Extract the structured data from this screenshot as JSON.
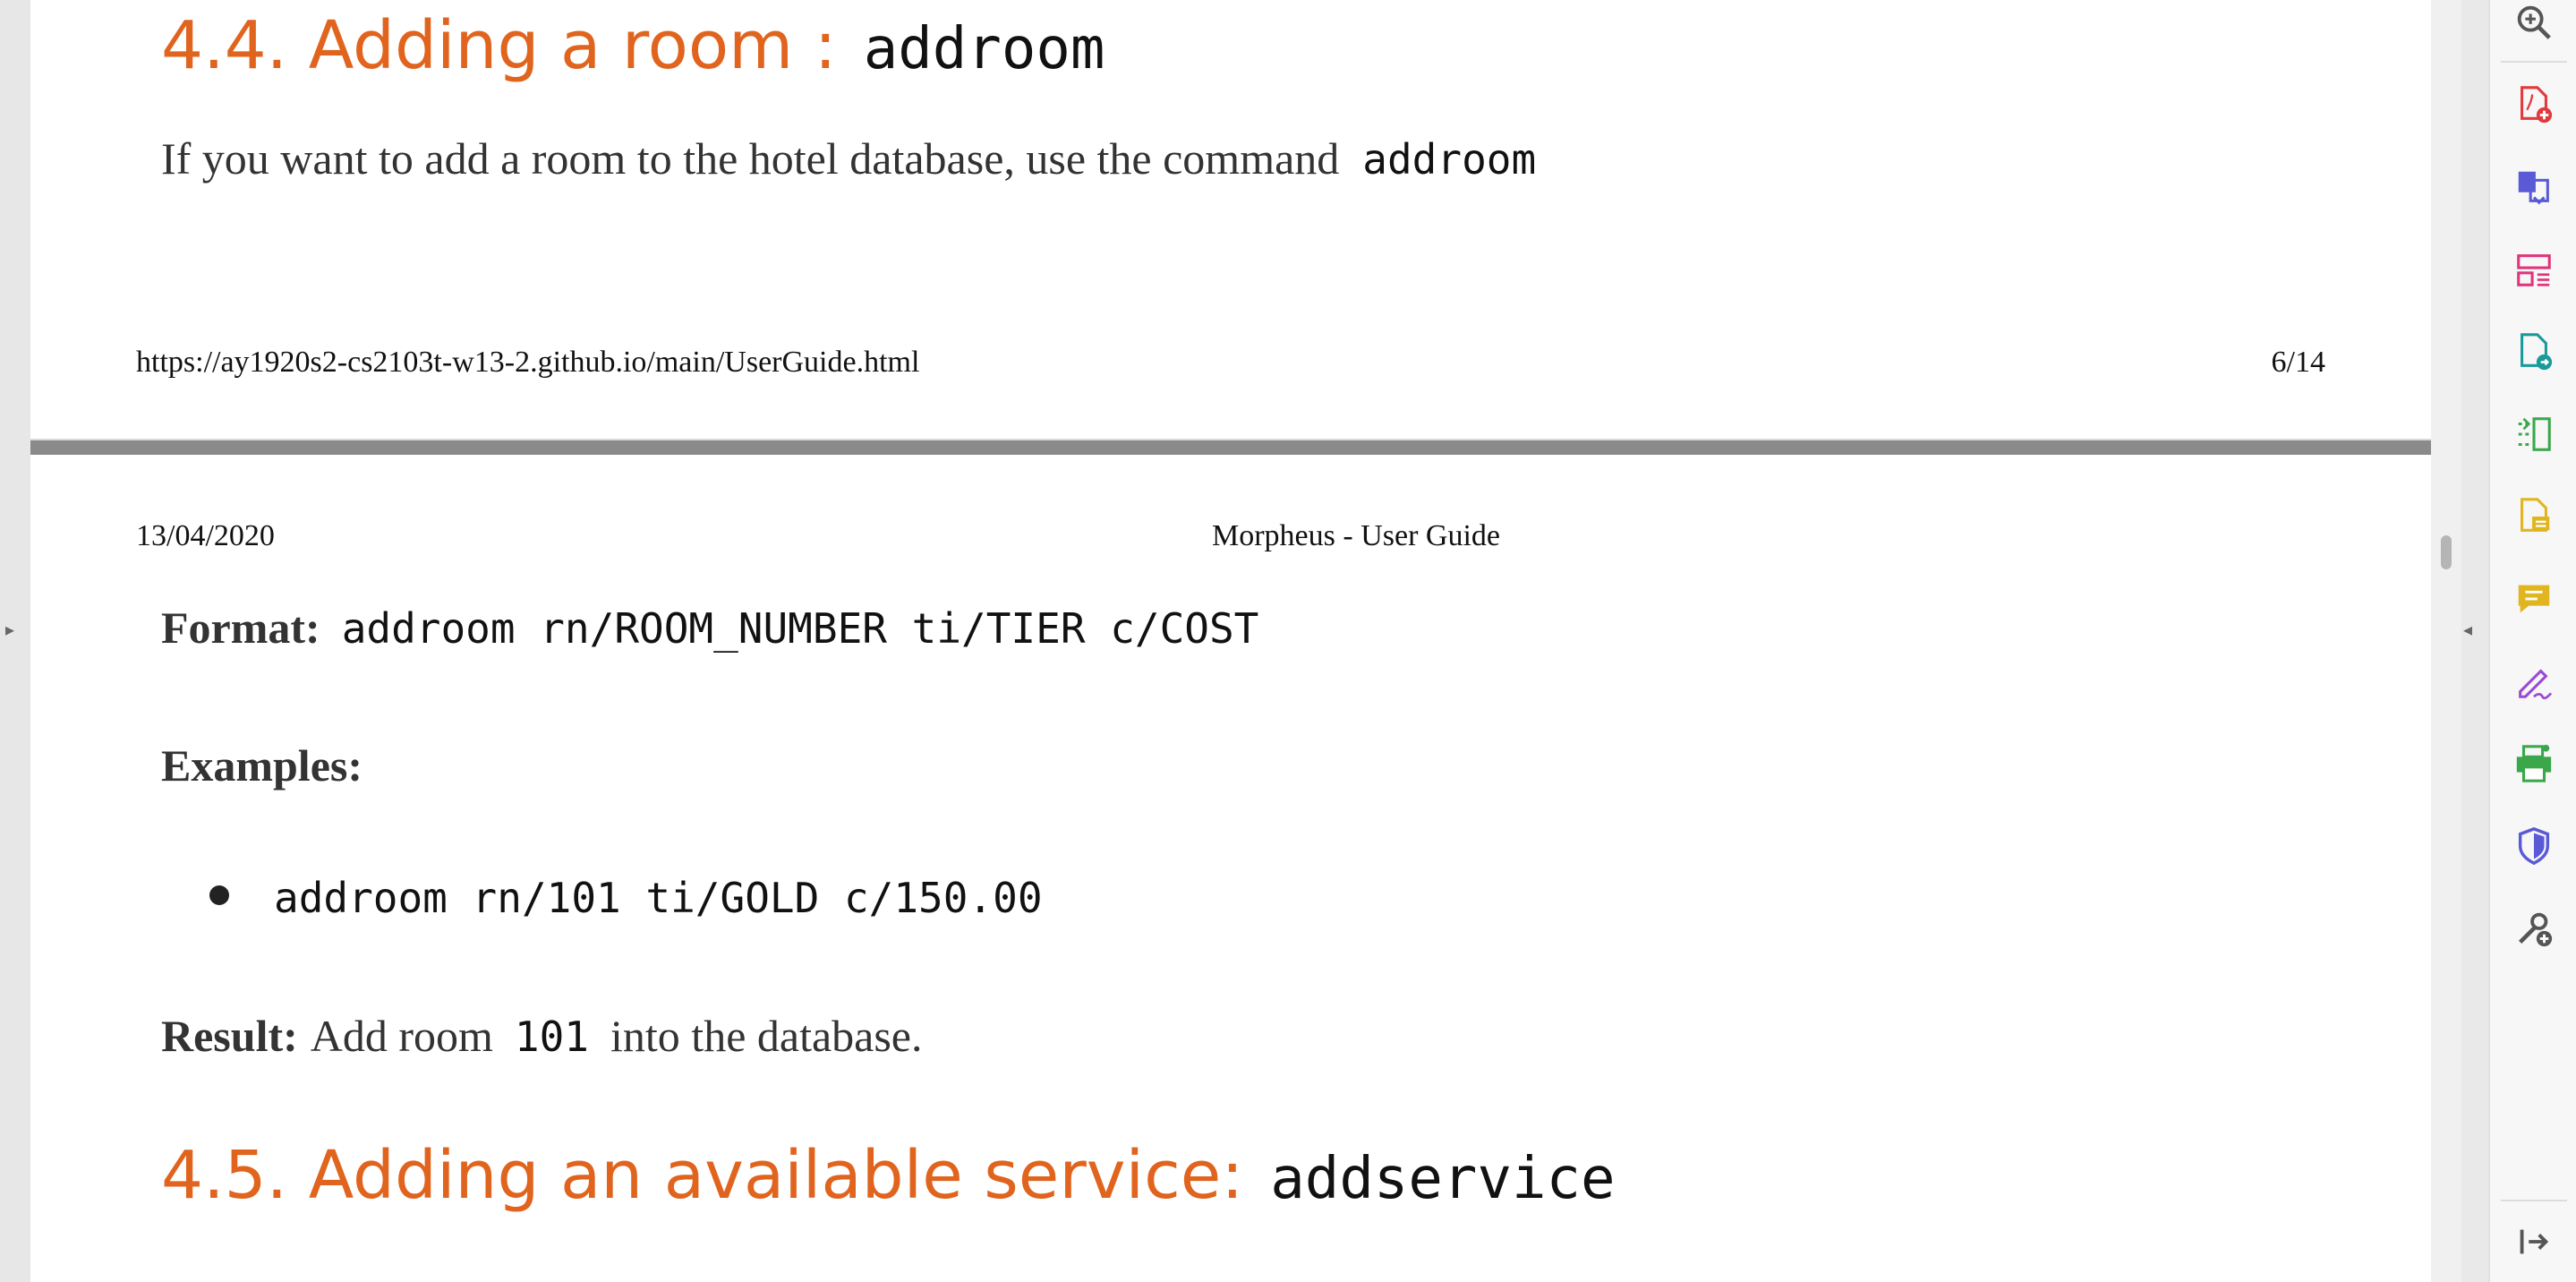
{
  "page1": {
    "heading": "4.4. Adding a room :",
    "heading_command": "addroom",
    "intro": "If you want to add a room to the hotel database, use the command",
    "intro_command": "addroom",
    "footer_url": "https://ay1920s2-cs2103t-w13-2.github.io/main/UserGuide.html",
    "footer_page": "6/14"
  },
  "page2": {
    "header_date": "13/04/2020",
    "header_title": "Morpheus - User Guide",
    "format_label": "Format:",
    "format_value": "addroom rn/ROOM_NUMBER ti/TIER c/COST",
    "examples_label": "Examples:",
    "examples": [
      "addroom rn/101 ti/GOLD c/150.00"
    ],
    "result_label": "Result:",
    "result_pre": "Add room",
    "result_code": "101",
    "result_post": "into the database.",
    "next_heading": "4.5. Adding an available service:",
    "next_heading_command": "addservice"
  },
  "toolbar": {
    "icons": [
      "zoom-icon",
      "create-pdf-icon",
      "combine-files-icon",
      "organize-pages-icon",
      "export-pdf-icon",
      "compress-icon",
      "edit-pdf-icon",
      "comment-icon",
      "fill-sign-icon",
      "print-production-icon",
      "protect-icon",
      "more-tools-icon",
      "collapse-panel-icon"
    ]
  },
  "colors": {
    "heading_orange": "#e0641e",
    "tool_red": "#e0393e",
    "tool_blue": "#5a5ad6",
    "tool_pink": "#e0357a",
    "tool_teal": "#1a9a9a",
    "tool_green": "#3aa84a",
    "tool_yellow": "#e0b520",
    "tool_purple": "#9a4ad6",
    "tool_gray": "#555555"
  }
}
